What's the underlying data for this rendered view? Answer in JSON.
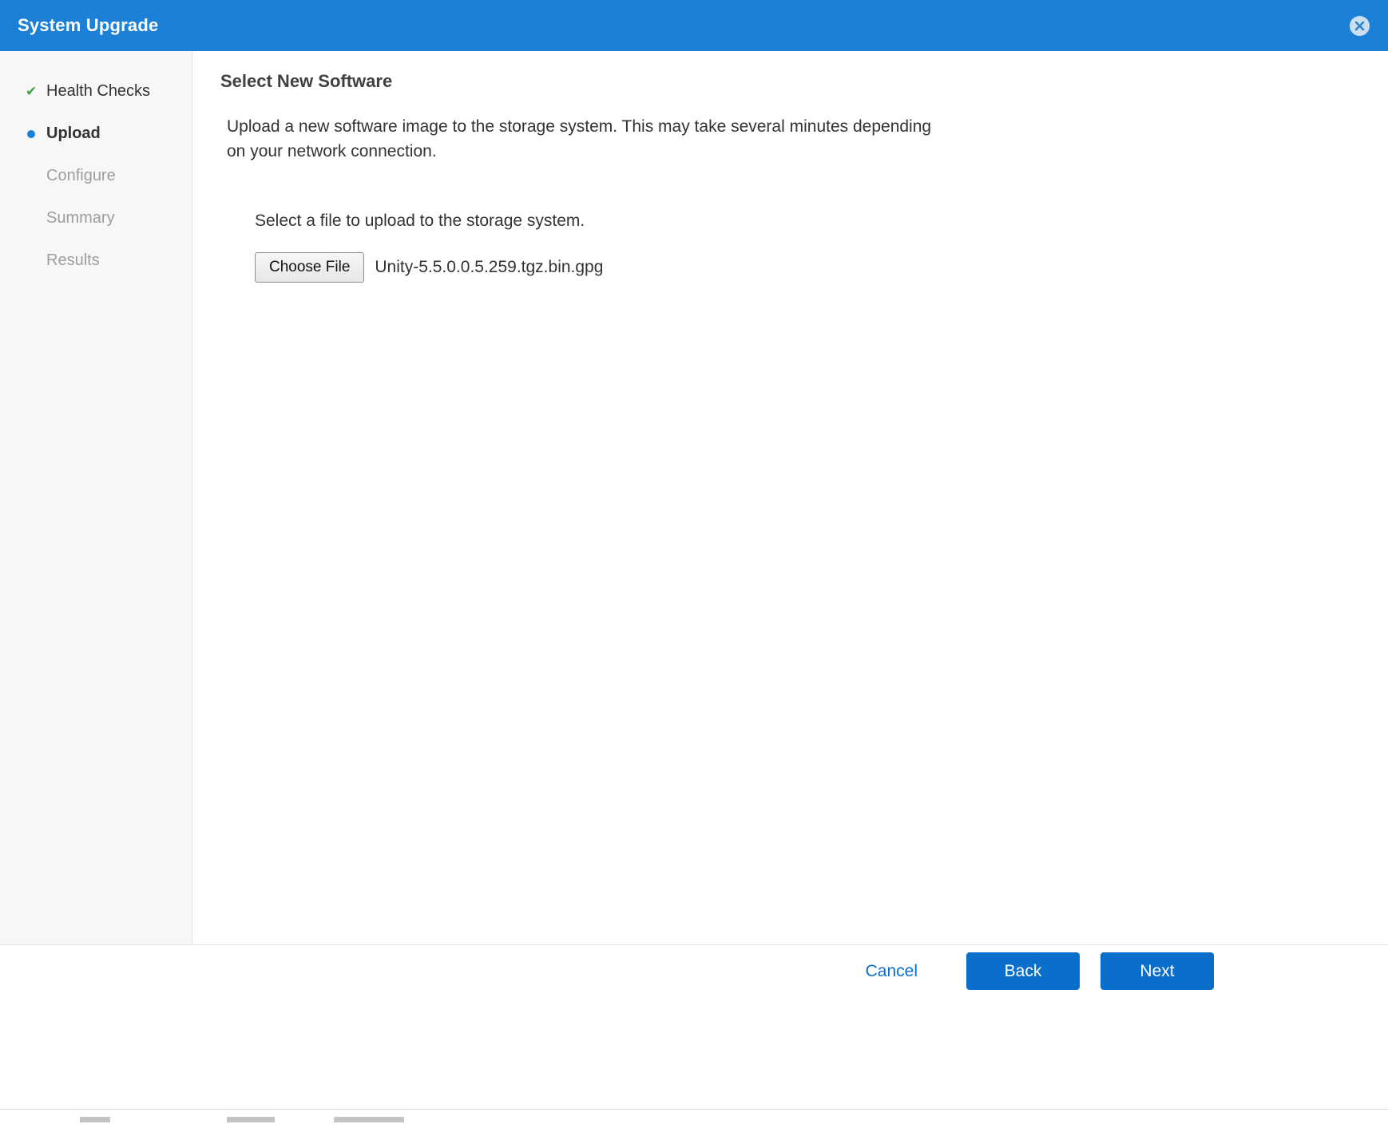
{
  "dialog": {
    "title": "System Upgrade"
  },
  "sidebar": {
    "items": [
      {
        "label": "Health Checks",
        "status": "completed"
      },
      {
        "label": "Upload",
        "status": "current"
      },
      {
        "label": "Configure",
        "status": "upcoming"
      },
      {
        "label": "Summary",
        "status": "upcoming"
      },
      {
        "label": "Results",
        "status": "upcoming"
      }
    ]
  },
  "main": {
    "heading": "Select New Software",
    "description_line1": "Upload a new software image to the storage system. This may take several minutes depending",
    "description_line2": "on your network connection.",
    "file_prompt": "Select a file to upload to the storage system.",
    "choose_file_label": "Choose File",
    "file_name": "Unity-5.5.0.0.5.259.tgz.bin.gpg"
  },
  "footer": {
    "cancel_label": "Cancel",
    "back_label": "Back",
    "next_label": "Next"
  },
  "colors": {
    "titlebar_blue": "#1c80d6",
    "primary_button_blue": "#0a6fca",
    "success_green": "#3da33f",
    "disabled_gray": "#9e9e9e"
  }
}
